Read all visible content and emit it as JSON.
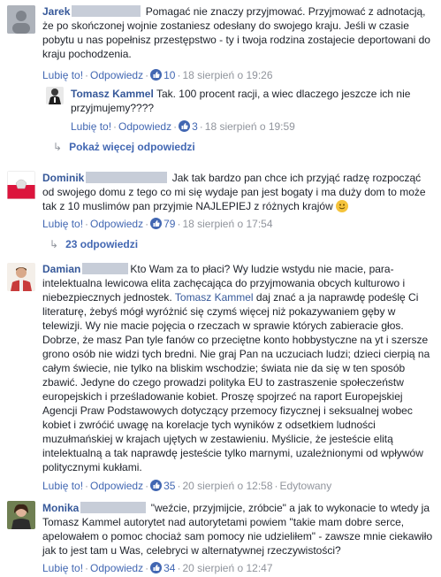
{
  "comments": [
    {
      "author": "Jarek",
      "text": "Pomagać nie znaczy przyjmować. Przyjmować z adnotacją, że po skończonej wojnie zostaniesz odesłany do swojego kraju. Jeśli w czasie pobytu u nas popełnisz przestępstwo - ty i twoja rodzina zostajecie deportowani do kraju pochodzenia.",
      "like_label": "Lubię to!",
      "reply_label": "Odpowiedz",
      "likes": "10",
      "time": "18 sierpień o 19:26"
    },
    {
      "author": "Tomasz Kammel",
      "text": "Tak. 100 procent racji, a wiec dlaczego jeszcze ich nie przyjmujemy????",
      "like_label": "Lubię to!",
      "reply_label": "Odpowiedz",
      "likes": "3",
      "time": "18 sierpień o 19:59"
    },
    {
      "author": "Dominik",
      "text": "Jak tak bardzo pan chce ich przyjąć radzę rozpocząć od swojego domu z tego co mi się wydaje pan jest bogaty i ma duży dom to może tak z 10 muslimów pan przyjmie NAJLEPIEJ z różnych krajów",
      "like_label": "Lubię to!",
      "reply_label": "Odpowiedz",
      "likes": "79",
      "time": "18 sierpień o 17:54"
    },
    {
      "author": "Damian",
      "text_a": "Kto Wam za to płaci? Wy ludzie wstydu nie macie, para-intelektualna lewicowa elita zachęcająca do przyjmowania obcych kulturowo i niebezpiecznych jednostek.",
      "mention": "Tomasz Kammel",
      "text_b": "daj znać a ja naprawdę podeślę Ci literaturę, żebyś mógł wyróżnić się czymś więcej niż pokazywaniem gęby w telewizji. Wy nie macie pojęcia o rzeczach w sprawie których zabieracie głos. Dobrze, że masz Pan tyle fanów co przeciętne konto hobbystyczne na yt i szersze grono osób nie widzi tych bredni. Nie graj Pan na uczuciach ludzi; dzieci cierpią na całym świecie, nie tylko na bliskim wschodzie; świata nie da się w ten sposób zbawić. Jedyne do czego prowadzi polityka EU to zastraszenie społeczeństw europejskich i prześladowanie kobiet. Proszę spojrzeć na raport Europejskiej Agencji Praw Podstawowych dotyczący przemocy fizycznej i seksualnej wobec kobiet i zwróćić uwagę na korelacje tych wyników z odsetkiem ludności muzułmańskiej w krajach ujętych w zestawieniu. Myślicie, że jesteście elitą intelektualną a tak naprawdę jesteście tylko marnymi, uzależnionymi od wpływów politycznymi kukłami.",
      "like_label": "Lubię to!",
      "reply_label": "Odpowiedz",
      "likes": "35",
      "time": "20 sierpień o 12:58",
      "edited": "Edytowany"
    },
    {
      "author": "Monika",
      "text": "\"weźcie, przyjmijcie, zróbcie\" a jak to wykonacie to wtedy ja Tomasz Kammel autorytet nad autorytetami powiem \"takie mam dobre serce, apelowałem o pomoc chociaż sam pomocy nie udzieliłem\" - zawsze mnie ciekawiło jak to jest tam u Was, celebryci w alternatywnej rzeczywistości?",
      "like_label": "Lubię to!",
      "reply_label": "Odpowiedz",
      "likes": "34",
      "time": "20 sierpień o 12:47"
    }
  ],
  "more_replies": "Pokaż więcej odpowiedzi",
  "replies_count": "23 odpowiedzi",
  "separator": "·"
}
